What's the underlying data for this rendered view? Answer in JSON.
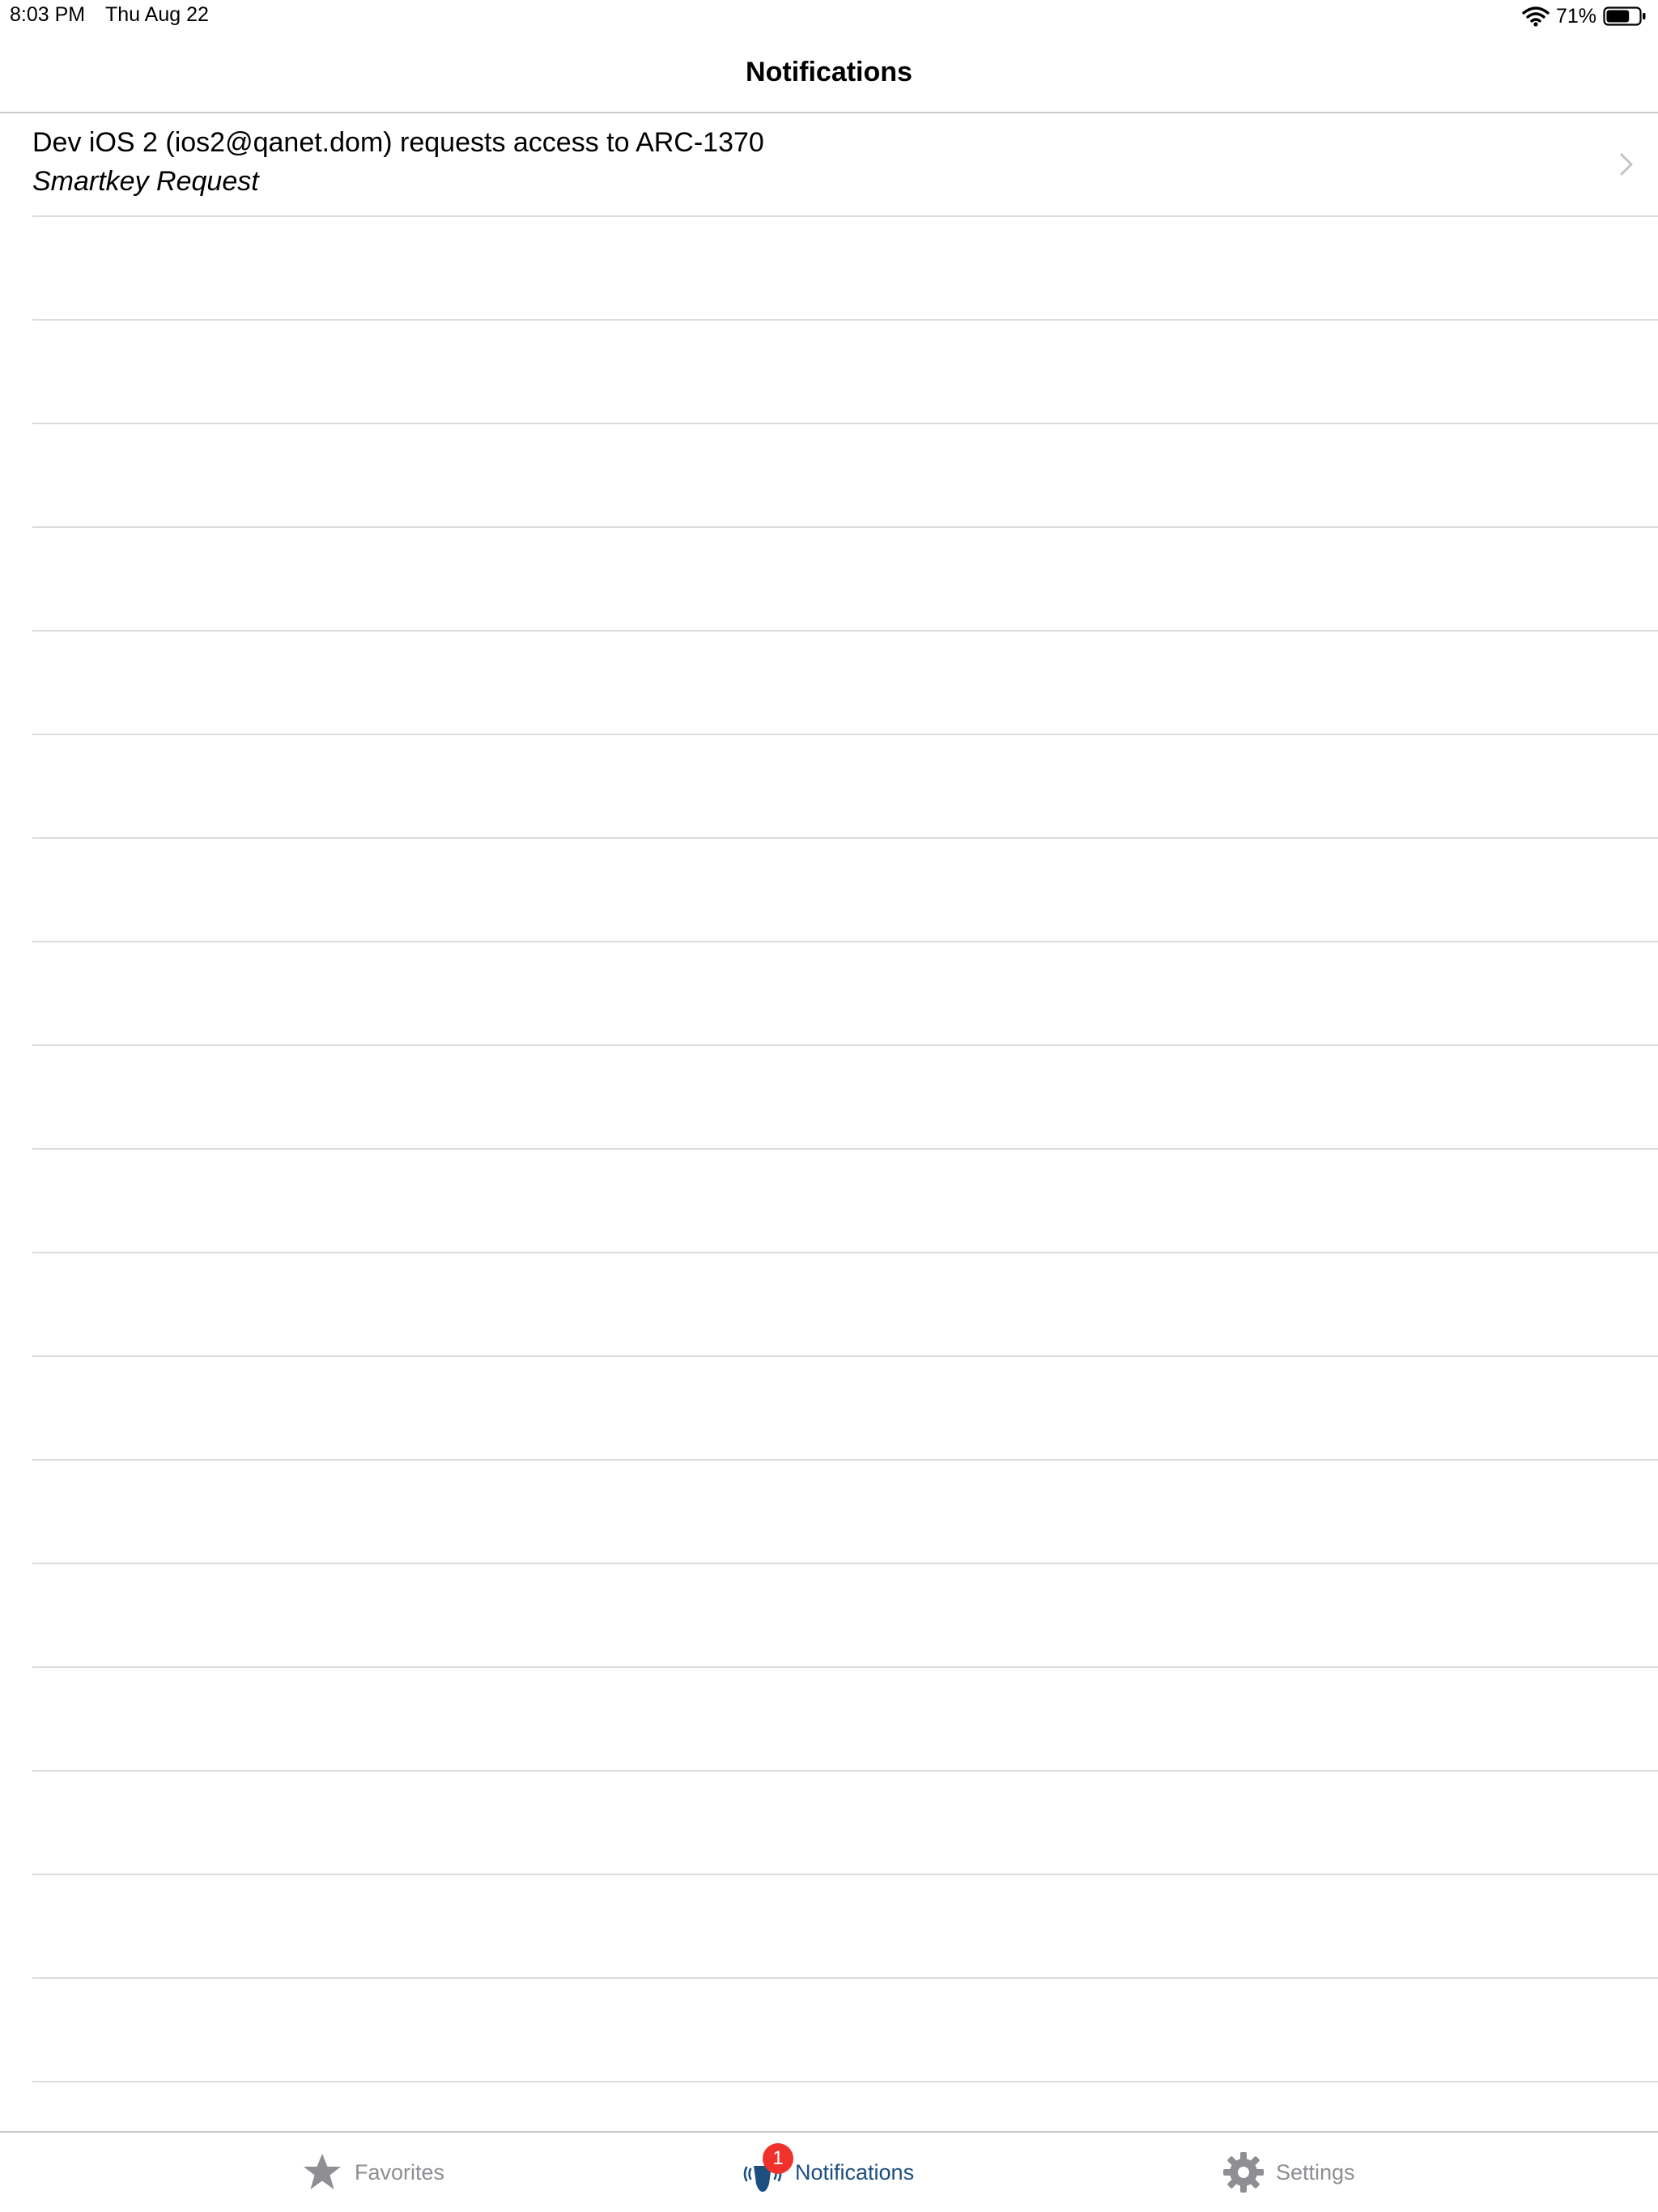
{
  "status_bar": {
    "time": "8:03 PM",
    "date": "Thu Aug 22",
    "battery_percent": "71%",
    "battery_level": 0.71,
    "wifi_icon": "wifi-icon",
    "battery_icon": "battery-icon"
  },
  "nav": {
    "title": "Notifications"
  },
  "notifications": [
    {
      "title": "Dev iOS 2 (ios2@qanet.dom) requests access to ARC-1370",
      "subtitle": "Smartkey Request",
      "accessory_icon": "chevron-right-icon"
    }
  ],
  "tab_bar": {
    "tabs": [
      {
        "label": "Favorites",
        "icon": "star-icon",
        "active": false
      },
      {
        "label": "Notifications",
        "icon": "smartkey-signal-icon",
        "active": true,
        "badge": "1"
      },
      {
        "label": "Settings",
        "icon": "gear-icon",
        "active": false
      }
    ]
  },
  "colors": {
    "active_tint": "#1c4f80",
    "inactive_tint": "#8e8e93",
    "badge": "#f0312c",
    "separator": "#dcdce0"
  }
}
